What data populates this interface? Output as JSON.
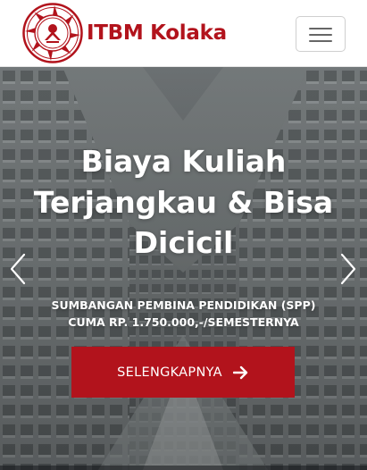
{
  "navbar": {
    "brand_name": "ITBM Kolaka",
    "brand_color": "#b2131c",
    "logo_icon": "itbm-logo-emblem",
    "toggler_icon": "hamburger-icon"
  },
  "hero": {
    "title_lines": [
      "Biaya Kuliah",
      "Terjangkau & Bisa",
      "Dicicil"
    ],
    "subtitle_lines": [
      "SUMBANGAN PEMBINA PENDIDIKAN (SPP)",
      "CUMA RP. 1.750.000,-/SEMESTERNYA"
    ],
    "cta_label": "SELENGKAPNYA",
    "cta_icon": "arrow-right-icon",
    "cta_color": "#b2131c",
    "prev_icon": "chevron-left-icon",
    "next_icon": "chevron-right-icon",
    "background": "campus-building-photo"
  }
}
